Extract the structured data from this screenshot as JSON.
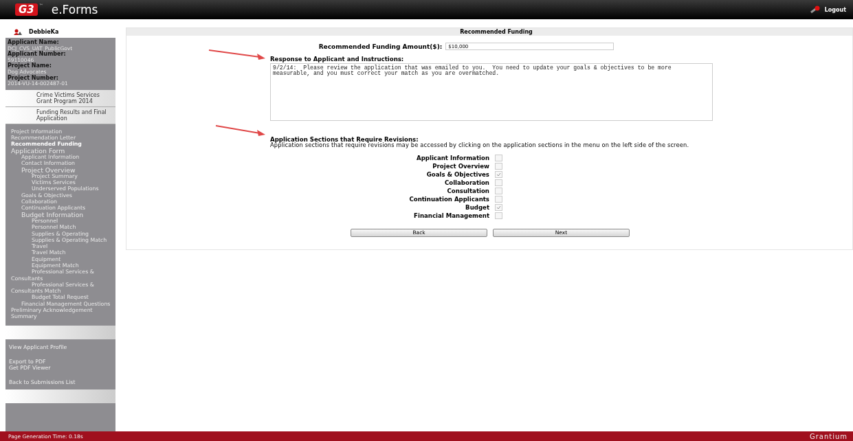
{
  "header": {
    "logo": "G3",
    "logo_mark": "™",
    "title": "e.Forms",
    "logout": "Logout"
  },
  "sidebar": {
    "user": "DebbieKa",
    "info": [
      {
        "label": "Applicant Name:",
        "value": "DCJ_CVS_UAT_PublicGovt"
      },
      {
        "label": "Applicant Number:",
        "value": "59110046"
      },
      {
        "label": "Project Name:",
        "value": "Dog Advocates"
      },
      {
        "label": "Project Number:",
        "value": "2014-VU-14-002487-01"
      }
    ],
    "programs": [
      "Crime Victims Services Grant Program 2014",
      "Funding Results and Final Application"
    ],
    "nav": [
      {
        "label": "Project Information",
        "selected": false
      },
      {
        "label": "Recommendation Letter",
        "selected": false
      },
      {
        "label": "Recommended Funding",
        "selected": true
      },
      {
        "label": "Application Form",
        "selected": false,
        "children": [
          {
            "label": "Applicant Information",
            "selected": false
          },
          {
            "label": "Contact Information",
            "selected": false
          },
          {
            "label": "Project Overview",
            "selected": false,
            "children": [
              {
                "label": "Project Summary",
                "selected": false
              },
              {
                "label": "Victims Services",
                "selected": false
              },
              {
                "label": "Underserved Populations",
                "selected": false
              }
            ]
          },
          {
            "label": "Goals & Objectives",
            "selected": false
          },
          {
            "label": "Collaboration",
            "selected": false
          },
          {
            "label": "Continuation Applicants",
            "selected": false
          },
          {
            "label": "Budget Information",
            "selected": false,
            "children": [
              {
                "label": "Personnel",
                "selected": false
              },
              {
                "label": "Personnel Match",
                "selected": false
              },
              {
                "label": "Supplies & Operating",
                "selected": false
              },
              {
                "label": "Supplies & Operating Match",
                "selected": false
              },
              {
                "label": "Travel",
                "selected": false
              },
              {
                "label": "Travel Match",
                "selected": false
              },
              {
                "label": "Equipment",
                "selected": false
              },
              {
                "label": "Equipment Match",
                "selected": false
              },
              {
                "label": "Professional Services & Consultants",
                "selected": false
              },
              {
                "label": "Professional Services & Consultants Match",
                "selected": false
              },
              {
                "label": "Budget Total Request",
                "selected": false
              }
            ]
          },
          {
            "label": "Financial Management Questions",
            "selected": false
          }
        ]
      },
      {
        "label": "Preliminary Acknowledgement",
        "selected": false
      },
      {
        "label": "Summary",
        "selected": false
      }
    ],
    "links": [
      [
        "View Applicant Profile"
      ],
      [
        "Export to PDF",
        "Get PDF Viewer"
      ],
      [
        "Back to Submissions List"
      ]
    ]
  },
  "main": {
    "title": "Recommended Funding",
    "amount_label": "Recommended Funding Amount($):",
    "amount_value": "$10,000",
    "response_label": "Response to Applicant and Instructions:",
    "response_value": "9/2/14:  Please review the application that was emailed to you.  You need to update your goals & objectives to be more measurable, and you must correct your match as you are overmatched.",
    "sections_heading": "Application Sections that Require Revisions:",
    "sections_note": "Application sections that require revisions may be accessed by clicking on the application sections in the menu on the left side of the screen.",
    "sections": [
      {
        "label": "Applicant Information",
        "checked": false
      },
      {
        "label": "Project Overview",
        "checked": false
      },
      {
        "label": "Goals & Objectives",
        "checked": true
      },
      {
        "label": "Collaboration",
        "checked": false
      },
      {
        "label": "Consultation",
        "checked": false
      },
      {
        "label": "Continuation Applicants",
        "checked": false
      },
      {
        "label": "Budget",
        "checked": true
      },
      {
        "label": "Financial Management",
        "checked": false
      }
    ],
    "buttons": [
      "Back",
      "Next"
    ]
  },
  "footer": {
    "generation_time": "Page Generation Time: 0.18s",
    "brand": "Grantium"
  }
}
